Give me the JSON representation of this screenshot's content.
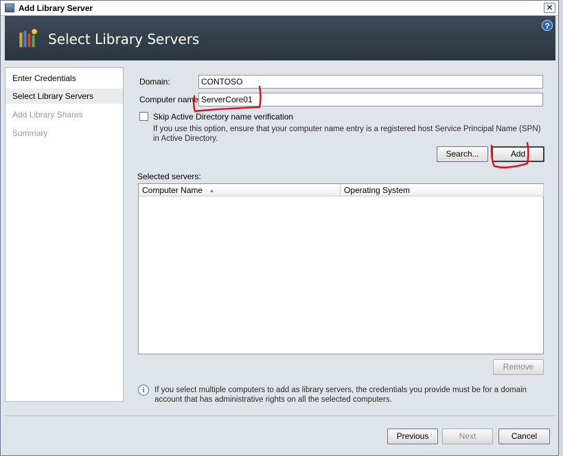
{
  "window": {
    "title": "Add Library Server",
    "close_glyph": "✕"
  },
  "banner": {
    "title": "Select Library Servers",
    "help_glyph": "?"
  },
  "nav": {
    "items": [
      {
        "label": "Enter Credentials",
        "state": "normal"
      },
      {
        "label": "Select Library Servers",
        "state": "active"
      },
      {
        "label": "Add Library Shares",
        "state": "disabled"
      },
      {
        "label": "Summary",
        "state": "disabled"
      }
    ]
  },
  "form": {
    "domain_label": "Domain:",
    "domain_value": "CONTOSO",
    "computer_label": "Computer name:",
    "computer_value": "ServerCore01",
    "skip_checkbox_label": "Skip Active Directory name verification",
    "skip_checked": false,
    "skip_hint": "If you use this option, ensure that your computer name entry is a registered host Service Principal Name (SPN) in Active Directory.",
    "search_button": "Search...",
    "add_button": "Add"
  },
  "servers": {
    "label": "Selected servers:",
    "columns": [
      "Computer Name",
      "Operating System"
    ],
    "sort_glyph": "▲",
    "rows": [],
    "remove_button": "Remove"
  },
  "info": {
    "glyph": "i",
    "text": "If you select multiple computers to add as library servers, the credentials you provide must be for a domain account that has administrative rights on all the selected computers."
  },
  "footer": {
    "previous_button": "Previous",
    "next_button": "Next",
    "cancel_button": "Cancel"
  },
  "colors": {
    "banner": "#2c3540",
    "annotation": "#e01020"
  }
}
